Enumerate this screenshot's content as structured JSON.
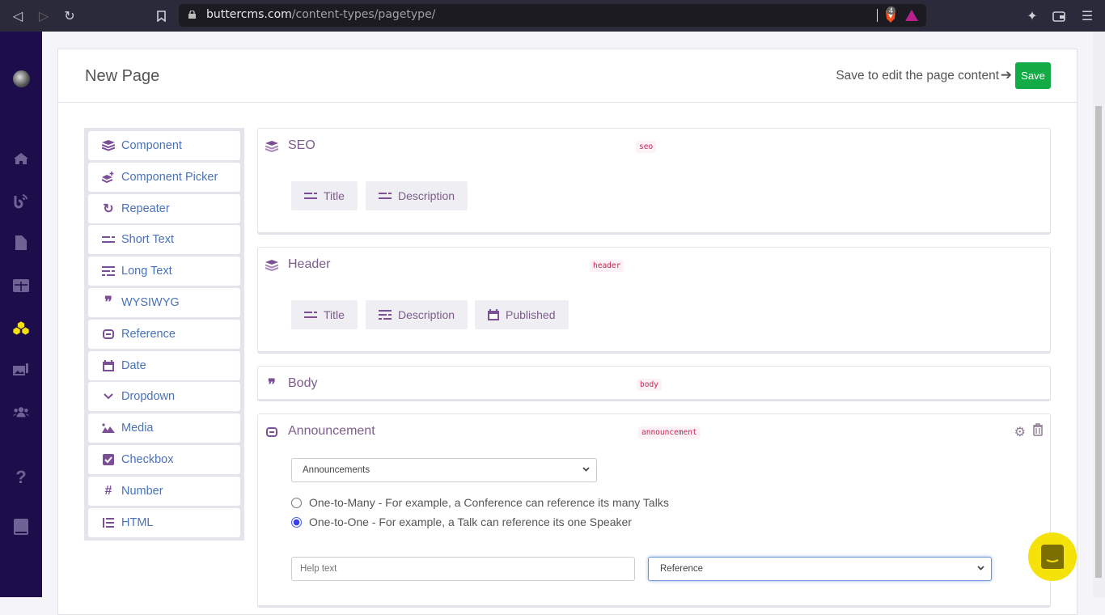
{
  "browser": {
    "url_domain": "buttercms.com",
    "url_path": "/content-types/pagetype/",
    "shield_count": "4"
  },
  "sidebar": {
    "items": [
      {
        "name": "home"
      },
      {
        "name": "blog"
      },
      {
        "name": "pages"
      },
      {
        "name": "collections"
      },
      {
        "name": "content-types",
        "active": true
      },
      {
        "name": "media"
      },
      {
        "name": "users"
      },
      {
        "name": "help"
      },
      {
        "name": "docs"
      }
    ]
  },
  "header": {
    "title": "New Page",
    "hint": "Save to edit the page content",
    "save_label": "Save"
  },
  "palette": {
    "items": [
      {
        "label": "Component",
        "icon": "layers"
      },
      {
        "label": "Component Picker",
        "icon": "layers-plus"
      },
      {
        "label": "Repeater",
        "icon": "repeat"
      },
      {
        "label": "Short Text",
        "icon": "short-text"
      },
      {
        "label": "Long Text",
        "icon": "long-text"
      },
      {
        "label": "WYSIWYG",
        "icon": "quote"
      },
      {
        "label": "Reference",
        "icon": "link"
      },
      {
        "label": "Date",
        "icon": "calendar"
      },
      {
        "label": "Dropdown",
        "icon": "chevron-down"
      },
      {
        "label": "Media",
        "icon": "image"
      },
      {
        "label": "Checkbox",
        "icon": "checkbox"
      },
      {
        "label": "Number",
        "icon": "hash"
      },
      {
        "label": "HTML",
        "icon": "list"
      }
    ]
  },
  "fields": {
    "seo": {
      "title": "SEO",
      "key": "seo",
      "chips": [
        "Title",
        "Description"
      ]
    },
    "header": {
      "title": "Header",
      "key": "header",
      "chips": [
        "Title",
        "Description",
        "Published"
      ]
    },
    "body": {
      "title": "Body",
      "key": "body"
    },
    "announcement": {
      "title": "Announcement",
      "key": "announcement",
      "collection_select": "Announcements",
      "radio_many": "One-to-Many - For example, a Conference can reference its many Talks",
      "radio_one": "One-to-One - For example, a Talk can reference its one Speaker",
      "selected": "one-to-one",
      "help_placeholder": "Help text",
      "type_select": "Reference"
    }
  },
  "colors": {
    "accent": "#7a4f96",
    "save": "#12ab45",
    "link": "#4a72b8",
    "sidebar": "#1d0d4a"
  }
}
